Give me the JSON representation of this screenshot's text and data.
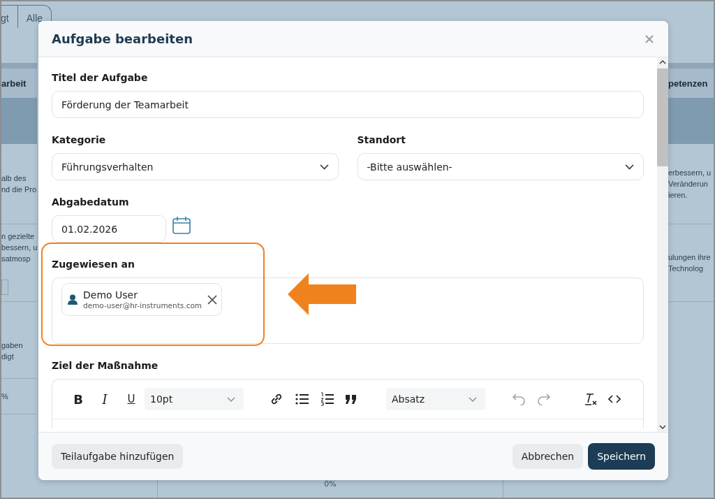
{
  "background": {
    "tabs": [
      {
        "label": "gt",
        "selected": false
      },
      {
        "label": "Alle",
        "selected": false
      }
    ],
    "left": {
      "header": "arbeit",
      "rows": [
        [
          "alb des ",
          "nd die Pro"
        ],
        [
          "n gezielte",
          "bessern, u",
          "satmosp"
        ],
        [
          "gaben",
          "digt"
        ],
        [
          "%"
        ]
      ]
    },
    "right": {
      "header": "petenzen",
      "rows": [
        [
          "erbessern, u",
          "Veränderun",
          "ieren."
        ],
        [
          "ulungen ihre",
          " Technolog"
        ]
      ]
    },
    "progress": "0%"
  },
  "dialog": {
    "title": "Aufgabe bearbeiten",
    "title_field": {
      "label": "Titel der Aufgabe",
      "value": "Förderung der Teamarbeit"
    },
    "selects": [
      {
        "label": "Kategorie",
        "value": "Führungsverhalten"
      },
      {
        "label": "Standort",
        "value": "-Bitte auswählen-"
      }
    ],
    "date": {
      "label": "Abgabedatum",
      "value": "01.02.2026"
    },
    "assigned": {
      "label": "Zugewiesen an",
      "highlighted": true,
      "users": [
        {
          "name": "Demo User",
          "email": "demo-user@hr-instruments.com"
        }
      ]
    },
    "editor": {
      "label": "Ziel der Maßnahme",
      "format_buttons": [
        {
          "kind": "bold",
          "label": "B"
        },
        {
          "kind": "italic",
          "label": "I"
        },
        {
          "kind": "underline",
          "label": "U"
        }
      ],
      "font_size": "10pt",
      "block_format": "Absatz",
      "undo_disabled": true,
      "redo_disabled": true
    },
    "footer": {
      "left_button": "Teilaufgabe hinzufügen",
      "buttons": [
        {
          "label": "Abbrechen",
          "kind": "secondary"
        },
        {
          "label": "Speichern",
          "kind": "primary"
        }
      ]
    }
  }
}
